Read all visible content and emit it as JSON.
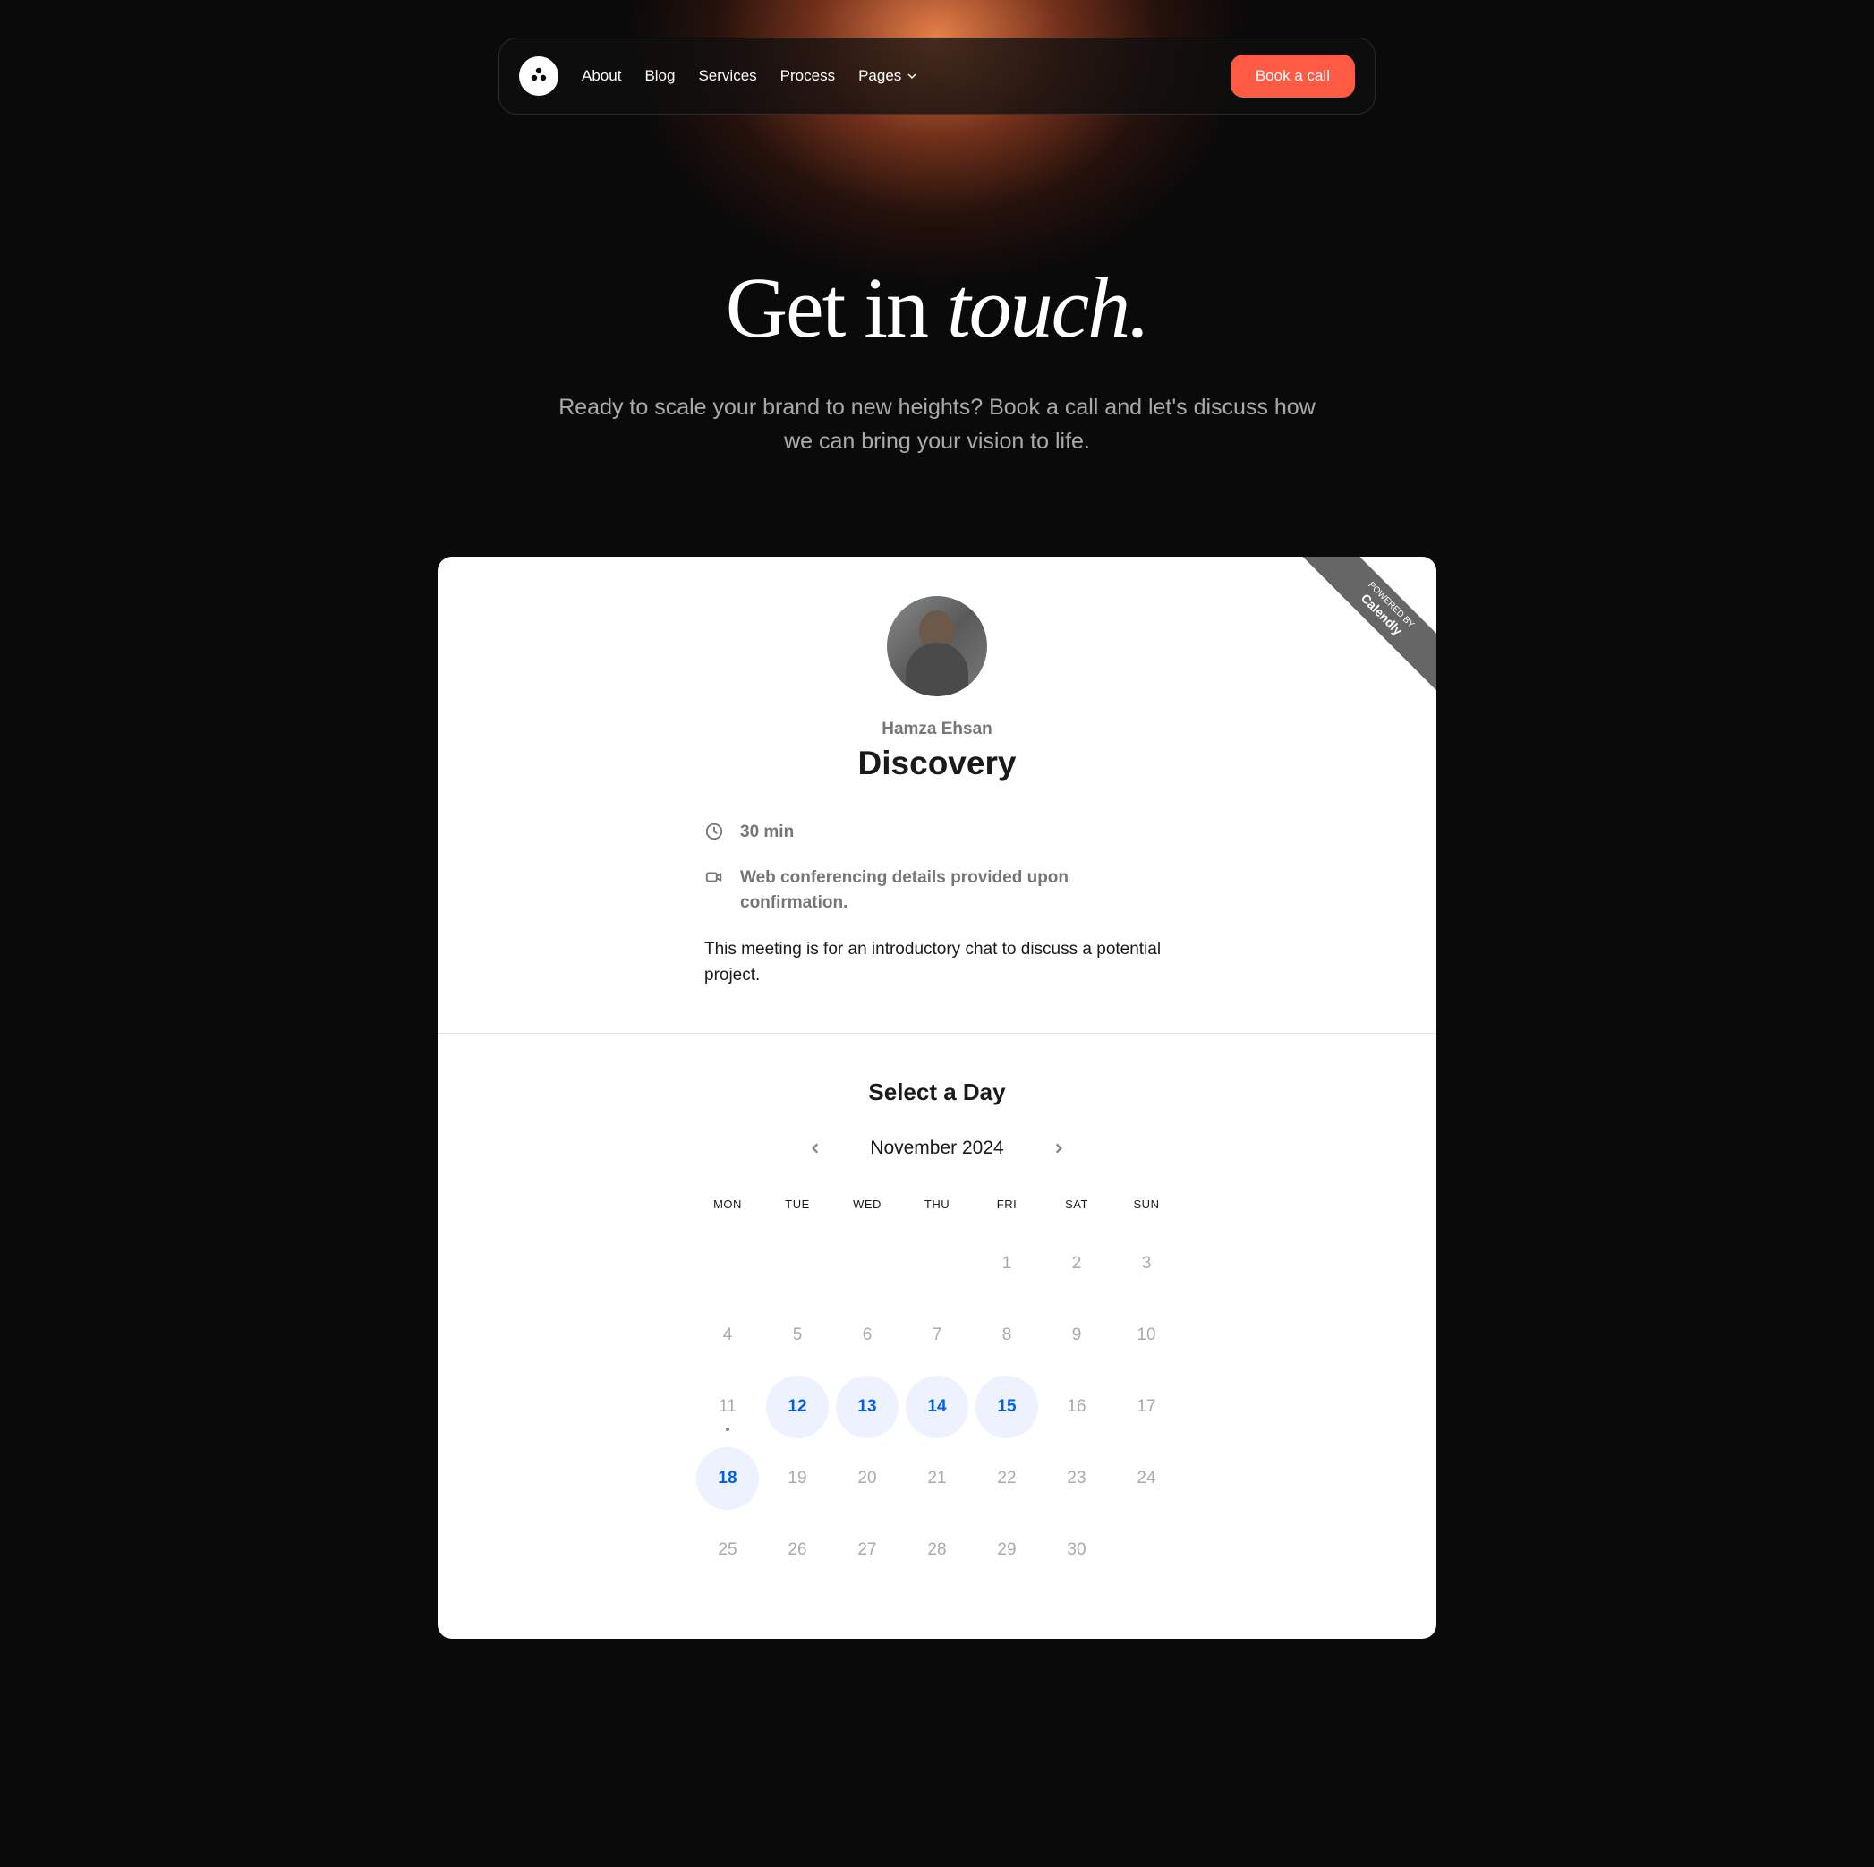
{
  "nav": {
    "links": [
      "About",
      "Blog",
      "Services",
      "Process",
      "Pages"
    ],
    "cta": "Book a call"
  },
  "hero": {
    "title_plain": "Get in ",
    "title_italic": "touch.",
    "subtitle": "Ready to scale your brand to new heights? Book a call and let's discuss how we can bring your vision to life."
  },
  "ribbon": {
    "small": "POWERED BY",
    "brand": "Calendly"
  },
  "meeting": {
    "host": "Hamza Ehsan",
    "title": "Discovery",
    "duration": "30 min",
    "location": "Web conferencing details provided upon confirmation.",
    "description": "This meeting is for an introductory chat to discuss a potential project."
  },
  "calendar": {
    "select_label": "Select a Day",
    "month_label": "November 2024",
    "dow": [
      "MON",
      "TUE",
      "WED",
      "THU",
      "FRI",
      "SAT",
      "SUN"
    ],
    "leading_blanks": 4,
    "days": [
      {
        "n": "1",
        "available": false
      },
      {
        "n": "2",
        "available": false
      },
      {
        "n": "3",
        "available": false
      },
      {
        "n": "4",
        "available": false
      },
      {
        "n": "5",
        "available": false
      },
      {
        "n": "6",
        "available": false
      },
      {
        "n": "7",
        "available": false
      },
      {
        "n": "8",
        "available": false
      },
      {
        "n": "9",
        "available": false
      },
      {
        "n": "10",
        "available": false
      },
      {
        "n": "11",
        "available": false,
        "today": true
      },
      {
        "n": "12",
        "available": true
      },
      {
        "n": "13",
        "available": true
      },
      {
        "n": "14",
        "available": true
      },
      {
        "n": "15",
        "available": true
      },
      {
        "n": "16",
        "available": false
      },
      {
        "n": "17",
        "available": false
      },
      {
        "n": "18",
        "available": true
      },
      {
        "n": "19",
        "available": false
      },
      {
        "n": "20",
        "available": false
      },
      {
        "n": "21",
        "available": false
      },
      {
        "n": "22",
        "available": false
      },
      {
        "n": "23",
        "available": false
      },
      {
        "n": "24",
        "available": false
      },
      {
        "n": "25",
        "available": false
      },
      {
        "n": "26",
        "available": false
      },
      {
        "n": "27",
        "available": false
      },
      {
        "n": "28",
        "available": false
      },
      {
        "n": "29",
        "available": false
      },
      {
        "n": "30",
        "available": false
      }
    ]
  }
}
